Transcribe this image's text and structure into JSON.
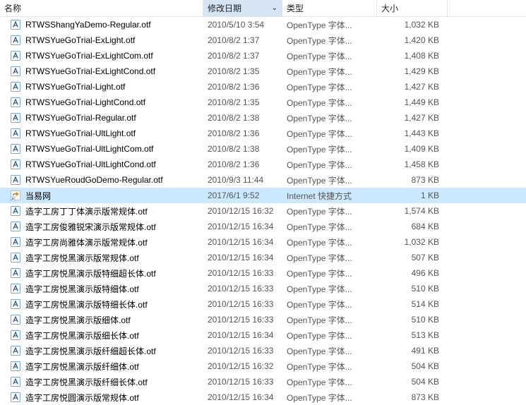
{
  "columns": {
    "name": "名称",
    "date": "修改日期",
    "type": "类型",
    "size": "大小"
  },
  "sorted_column": "date",
  "files": [
    {
      "icon": "font",
      "name": "RTWSShangYaDemo-Regular.otf",
      "date": "2010/5/10 3:54",
      "type": "OpenType 字体...",
      "size": "1,032 KB",
      "selected": false
    },
    {
      "icon": "font",
      "name": "RTWSYueGoTrial-ExLight.otf",
      "date": "2010/8/2 1:37",
      "type": "OpenType 字体...",
      "size": "1,420 KB",
      "selected": false
    },
    {
      "icon": "font",
      "name": "RTWSYueGoTrial-ExLightCom.otf",
      "date": "2010/8/2 1:37",
      "type": "OpenType 字体...",
      "size": "1,408 KB",
      "selected": false
    },
    {
      "icon": "font",
      "name": "RTWSYueGoTrial-ExLightCond.otf",
      "date": "2010/8/2 1:35",
      "type": "OpenType 字体...",
      "size": "1,429 KB",
      "selected": false
    },
    {
      "icon": "font",
      "name": "RTWSYueGoTrial-Light.otf",
      "date": "2010/8/2 1:36",
      "type": "OpenType 字体...",
      "size": "1,427 KB",
      "selected": false
    },
    {
      "icon": "font",
      "name": "RTWSYueGoTrial-LightCond.otf",
      "date": "2010/8/2 1:35",
      "type": "OpenType 字体...",
      "size": "1,449 KB",
      "selected": false
    },
    {
      "icon": "font",
      "name": "RTWSYueGoTrial-Regular.otf",
      "date": "2010/8/2 1:38",
      "type": "OpenType 字体...",
      "size": "1,427 KB",
      "selected": false
    },
    {
      "icon": "font",
      "name": "RTWSYueGoTrial-UltLight.otf",
      "date": "2010/8/2 1:36",
      "type": "OpenType 字体...",
      "size": "1,443 KB",
      "selected": false
    },
    {
      "icon": "font",
      "name": "RTWSYueGoTrial-UltLightCom.otf",
      "date": "2010/8/2 1:38",
      "type": "OpenType 字体...",
      "size": "1,409 KB",
      "selected": false
    },
    {
      "icon": "font",
      "name": "RTWSYueGoTrial-UltLightCond.otf",
      "date": "2010/8/2 1:36",
      "type": "OpenType 字体...",
      "size": "1,458 KB",
      "selected": false
    },
    {
      "icon": "font",
      "name": "RTWSYueRoudGoDemo-Regular.otf",
      "date": "2010/9/3 11:44",
      "type": "OpenType 字体...",
      "size": "873 KB",
      "selected": false
    },
    {
      "icon": "shortcut",
      "name": "当易网",
      "date": "2017/6/1 9:52",
      "type": "Internet 快捷方式",
      "size": "1 KB",
      "selected": true
    },
    {
      "icon": "font",
      "name": "造字工房丁丁体演示版常规体.otf",
      "date": "2010/12/15 16:32",
      "type": "OpenType 字体...",
      "size": "1,574 KB",
      "selected": false
    },
    {
      "icon": "font",
      "name": "造字工房俊雅锐宋演示版常规体.otf",
      "date": "2010/12/15 16:34",
      "type": "OpenType 字体...",
      "size": "684 KB",
      "selected": false
    },
    {
      "icon": "font",
      "name": "造字工房尚雅体演示版常规体.otf",
      "date": "2010/12/15 16:34",
      "type": "OpenType 字体...",
      "size": "1,032 KB",
      "selected": false
    },
    {
      "icon": "font",
      "name": "造字工房悦黑演示版常规体.otf",
      "date": "2010/12/15 16:34",
      "type": "OpenType 字体...",
      "size": "507 KB",
      "selected": false
    },
    {
      "icon": "font",
      "name": "造字工房悦黑演示版特细超长体.otf",
      "date": "2010/12/15 16:33",
      "type": "OpenType 字体...",
      "size": "496 KB",
      "selected": false
    },
    {
      "icon": "font",
      "name": "造字工房悦黑演示版特细体.otf",
      "date": "2010/12/15 16:33",
      "type": "OpenType 字体...",
      "size": "510 KB",
      "selected": false
    },
    {
      "icon": "font",
      "name": "造字工房悦黑演示版特细长体.otf",
      "date": "2010/12/15 16:33",
      "type": "OpenType 字体...",
      "size": "514 KB",
      "selected": false
    },
    {
      "icon": "font",
      "name": "造字工房悦黑演示版细体.otf",
      "date": "2010/12/15 16:33",
      "type": "OpenType 字体...",
      "size": "510 KB",
      "selected": false
    },
    {
      "icon": "font",
      "name": "造字工房悦黑演示版细长体.otf",
      "date": "2010/12/15 16:34",
      "type": "OpenType 字体...",
      "size": "513 KB",
      "selected": false
    },
    {
      "icon": "font",
      "name": "造字工房悦黑演示版纤细超长体.otf",
      "date": "2010/12/15 16:33",
      "type": "OpenType 字体...",
      "size": "491 KB",
      "selected": false
    },
    {
      "icon": "font",
      "name": "造字工房悦黑演示版纤细体.otf",
      "date": "2010/12/15 16:32",
      "type": "OpenType 字体...",
      "size": "504 KB",
      "selected": false
    },
    {
      "icon": "font",
      "name": "造字工房悦黑演示版纤细长体.otf",
      "date": "2010/12/15 16:33",
      "type": "OpenType 字体...",
      "size": "504 KB",
      "selected": false
    },
    {
      "icon": "font",
      "name": "造字工房悦圆演示版常规体.otf",
      "date": "2010/12/15 16:34",
      "type": "OpenType 字体...",
      "size": "873 KB",
      "selected": false
    }
  ]
}
